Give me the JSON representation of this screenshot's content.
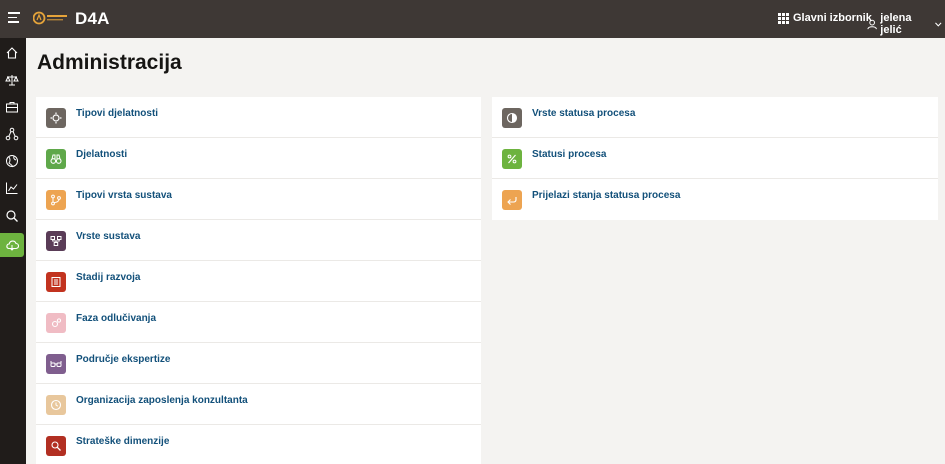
{
  "header": {
    "app_title": "D4A",
    "main_menu_label": "Glavni izbornik",
    "user_name": "jelena jelić"
  },
  "page": {
    "title": "Administracija"
  },
  "sidebar": {
    "items": [
      {
        "name": "home-icon"
      },
      {
        "name": "scale-icon"
      },
      {
        "name": "briefcase-icon"
      },
      {
        "name": "hierarchy-icon"
      },
      {
        "name": "globe-icon"
      },
      {
        "name": "chart-icon"
      },
      {
        "name": "search-icon"
      },
      {
        "name": "cloud-icon",
        "active": true
      }
    ]
  },
  "left_list": [
    {
      "label": "Tipovi djelatnosti",
      "color": "#6d6660",
      "icon": "gear-icon"
    },
    {
      "label": "Djelatnosti",
      "color": "#5fa84a",
      "icon": "binoculars-icon"
    },
    {
      "label": "Tipovi vrsta sustava",
      "color": "#eda451",
      "icon": "branch-icon"
    },
    {
      "label": "Vrste sustava",
      "color": "#5a3c57",
      "icon": "network-icon"
    },
    {
      "label": "Stadij razvoja",
      "color": "#c2331f",
      "icon": "building-icon"
    },
    {
      "label": "Faza odlučivanja",
      "color": "#f0bcc4",
      "icon": "gears-icon"
    },
    {
      "label": "Područje ekspertize",
      "color": "#7f5e8e",
      "icon": "glasses-icon"
    },
    {
      "label": "Organizacija zaposlenja konzultanta",
      "color": "#e8c79c",
      "icon": "clock-icon"
    },
    {
      "label": "Strateške dimenzije",
      "color": "#b22f22",
      "icon": "magnifier-icon"
    }
  ],
  "right_list": [
    {
      "label": "Vrste statusa procesa",
      "color": "#6d6660",
      "icon": "half-circle-icon"
    },
    {
      "label": "Statusi procesa",
      "color": "#6db33f",
      "icon": "percent-icon"
    },
    {
      "label": "Prijelazi stanja statusa procesa",
      "color": "#eda451",
      "icon": "return-arrow-icon"
    }
  ]
}
